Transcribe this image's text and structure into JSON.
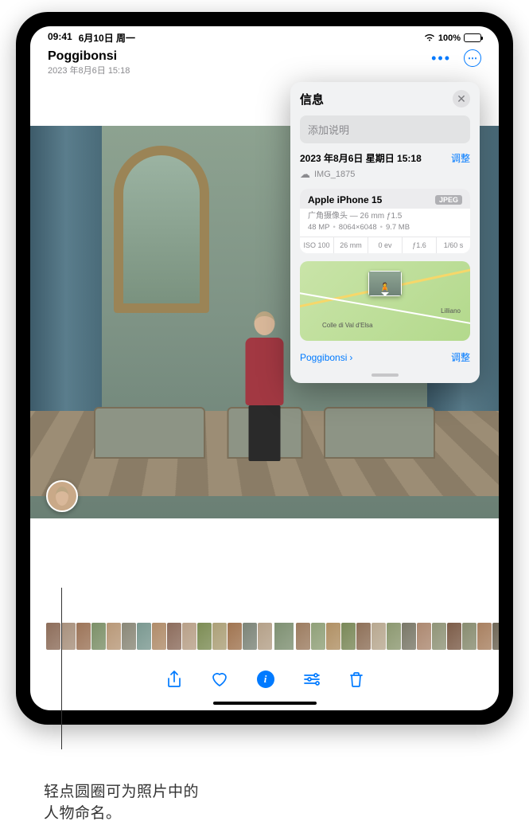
{
  "status": {
    "time": "09:41",
    "date": "6月10日 周一",
    "battery": "100%"
  },
  "header": {
    "title": "Poggibonsi",
    "subtitle": "2023 年8月6日  15:18"
  },
  "info_panel": {
    "title": "信息",
    "caption_placeholder": "添加说明",
    "date_line": "2023 年8月6日 星期日 15:18",
    "adjust": "调整",
    "filename": "IMG_1875",
    "camera": {
      "device": "Apple iPhone 15",
      "badge": "JPEG",
      "lens": "广角摄像头 — 26 mm ƒ1.5",
      "mp": "48 MP",
      "dims": "8064×6048",
      "size": "9.7 MB",
      "exif": {
        "iso": "ISO 100",
        "focal": "26 mm",
        "ev": "0 ev",
        "aperture": "ƒ1.6",
        "shutter": "1/60 s"
      }
    },
    "map": {
      "label1": "Colle di Val d'Elsa",
      "label2": "Lilliano"
    },
    "location": "Poggibonsi",
    "adjust2": "调整"
  },
  "thumbnail_colors": [
    "#8d6d5a",
    "#a8907c",
    "#9c7458",
    "#7c9068",
    "#b89878",
    "#8a8878",
    "#7a9890",
    "#b08c6a",
    "#8c6c5c",
    "#b8a088",
    "#7c8c54",
    "#aca078",
    "#a07450",
    "#7c8478",
    "#b4a088",
    "#7e9072",
    "#9c7c60",
    "#90a078",
    "#b09064",
    "#7a8858",
    "#8e7058",
    "#b8a890",
    "#8c9870",
    "#7a7868",
    "#ac8870",
    "#909478",
    "#7c5c48",
    "#888c70",
    "#a88060",
    "#706858",
    "#8c9878"
  ],
  "callout": {
    "line1": "轻点圆圈可为照片中的",
    "line2": "人物命名。"
  }
}
